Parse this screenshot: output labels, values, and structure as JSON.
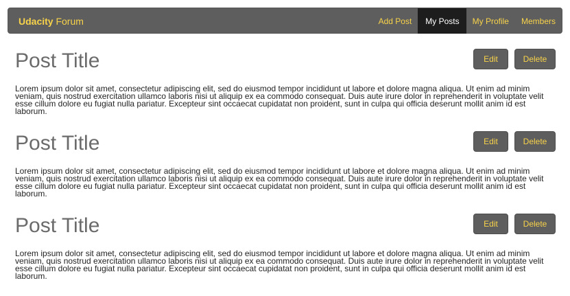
{
  "navbar": {
    "brand_bold": "Udacity",
    "brand_rest": " Forum",
    "links": [
      {
        "label": "Add Post",
        "active": false
      },
      {
        "label": "My Posts",
        "active": true
      },
      {
        "label": "My Profile",
        "active": false
      },
      {
        "label": "Members",
        "active": false
      }
    ]
  },
  "posts": [
    {
      "title": "Post Title",
      "edit_label": "Edit",
      "delete_label": "Delete",
      "body": "Lorem ipsum dolor sit amet, consectetur adipiscing elit, sed do eiusmod tempor incididunt ut labore et dolore magna aliqua. Ut enim ad minim veniam, quis nostrud exercitation ullamco laboris nisi ut aliquip ex ea commodo consequat. Duis aute irure dolor in reprehenderit in voluptate velit esse cillum dolore eu fugiat nulla pariatur. Excepteur sint occaecat cupidatat non proident, sunt in culpa qui officia deserunt mollit anim id est laborum."
    },
    {
      "title": "Post Title",
      "edit_label": "Edit",
      "delete_label": "Delete",
      "body": "Lorem ipsum dolor sit amet, consectetur adipiscing elit, sed do eiusmod tempor incididunt ut labore et dolore magna aliqua. Ut enim ad minim veniam, quis nostrud exercitation ullamco laboris nisi ut aliquip ex ea commodo consequat. Duis aute irure dolor in reprehenderit in voluptate velit esse cillum dolore eu fugiat nulla pariatur. Excepteur sint occaecat cupidatat non proident, sunt in culpa qui officia deserunt mollit anim id est laborum."
    },
    {
      "title": "Post Title",
      "edit_label": "Edit",
      "delete_label": "Delete",
      "body": "Lorem ipsum dolor sit amet, consectetur adipiscing elit, sed do eiusmod tempor incididunt ut labore et dolore magna aliqua. Ut enim ad minim veniam, quis nostrud exercitation ullamco laboris nisi ut aliquip ex ea commodo consequat. Duis aute irure dolor in reprehenderit in voluptate velit esse cillum dolore eu fugiat nulla pariatur. Excepteur sint occaecat cupidatat non proident, sunt in culpa qui officia deserunt mollit anim id est laborum."
    }
  ],
  "colors": {
    "navbar_bg": "#5e5e5e",
    "accent": "#f8d34a",
    "active_bg": "#1d1d1d",
    "title": "#6b6b6b"
  }
}
